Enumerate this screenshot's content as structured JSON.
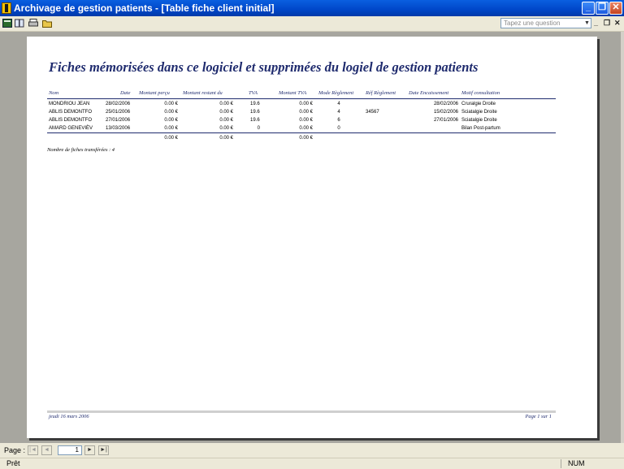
{
  "window": {
    "title": "Archivage de gestion patients - [Table fiche client initial]",
    "controls": {
      "minimize": "_",
      "restore": "❐",
      "close": "✕"
    }
  },
  "toolbar": {
    "icons": [
      "view-icon",
      "book-icon",
      "print-icon",
      "folder-icon"
    ],
    "ask_placeholder": "Tapez une question",
    "mdi": {
      "minimize": "_",
      "restore": "❐",
      "close": "✕"
    }
  },
  "report": {
    "title": "Fiches mémorisées dans ce logiciel et supprimées du logiel de gestion patients",
    "columns": {
      "nom": "Nom",
      "date": "Date",
      "montant_percu": "Montant perçu",
      "montant_restant": "Montant restant du",
      "tva": "TVA",
      "montant_tva": "Montant TVA",
      "mode": "Mode Règlement",
      "ref": "Réf Règlement",
      "date_enc": "Date Encaissement",
      "motif": "Motif consultation"
    },
    "rows": [
      {
        "nom": "MONDRIOU JEAN",
        "date": "28/02/2006",
        "montant_percu": "0.00 €",
        "montant_restant": "0.00 €",
        "tva": "19.6",
        "montant_tva": "0.00 €",
        "mode": "4",
        "ref": "",
        "date_enc": "28/02/2006",
        "motif": "Cruralgie Droite"
      },
      {
        "nom": "ABLIS DEMONTFO",
        "date": "25/01/2006",
        "montant_percu": "0.00 €",
        "montant_restant": "0.00 €",
        "tva": "19.6",
        "montant_tva": "0.00 €",
        "mode": "4",
        "ref": "34567",
        "date_enc": "15/02/2006",
        "motif": "Sciatalgie Droite"
      },
      {
        "nom": "ABLIS DEMONTFO",
        "date": "27/01/2006",
        "montant_percu": "0.00 €",
        "montant_restant": "0.00 €",
        "tva": "19.6",
        "montant_tva": "0.00 €",
        "mode": "6",
        "ref": "",
        "date_enc": "27/01/2006",
        "motif": "Sciatalgie Droite"
      },
      {
        "nom": "AMARD GENEVIÈV",
        "date": "13/03/2006",
        "montant_percu": "0.00 €",
        "montant_restant": "0.00 €",
        "tva": "0",
        "montant_tva": "0.00 €",
        "mode": "0",
        "ref": "",
        "date_enc": "",
        "motif": "Bilan Post-partum"
      }
    ],
    "totals": {
      "montant_percu": "0.00 €",
      "montant_restant": "0.00 €",
      "montant_tva": "0.00 €"
    },
    "count_note": "Nombre de fiches transférées : 4",
    "footer_date": "jeudi 16 mars 2006",
    "footer_page": "Page 1 sur 1"
  },
  "navigation": {
    "label": "Page :",
    "current_page": "1",
    "buttons": {
      "first": "|◄",
      "prev": "◄",
      "next": "►",
      "last": "►|"
    }
  },
  "status": {
    "text": "Prêt",
    "num": "NUM"
  },
  "colors": {
    "title_bar": "#0046c8",
    "report_text": "#1f2b6e",
    "preview_bg": "#a7a69f"
  }
}
